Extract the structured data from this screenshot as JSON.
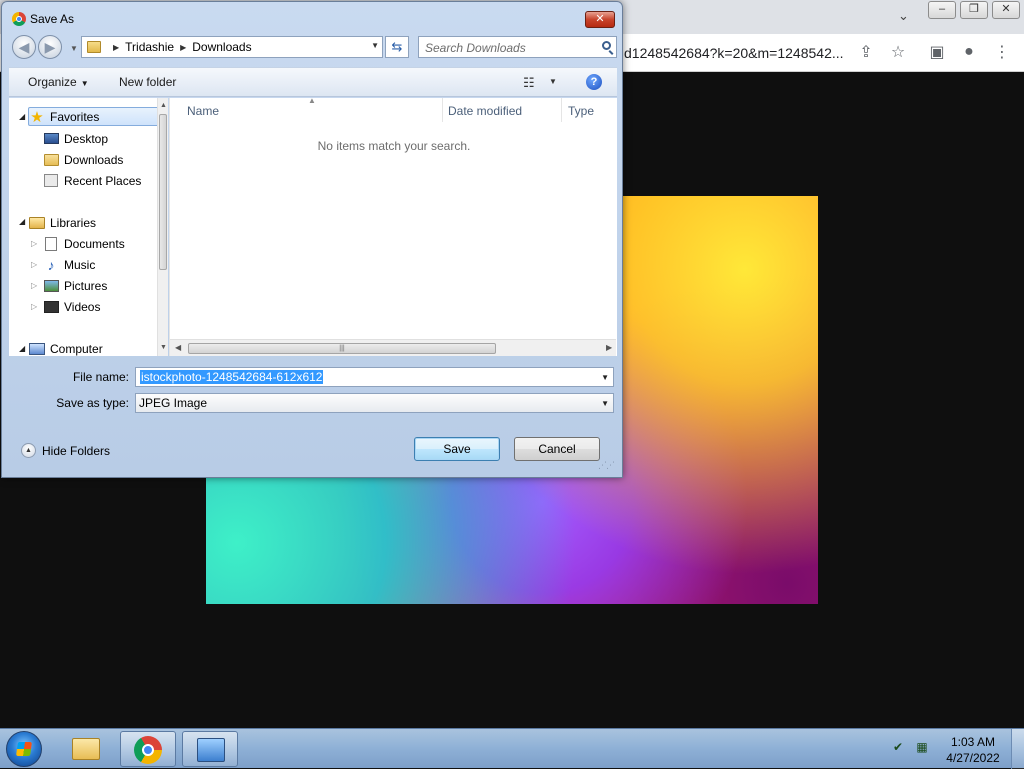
{
  "browser": {
    "url_fragment": "d1248542684?k=20&m=1248542...",
    "window_buttons": [
      "–",
      "❐",
      "✕"
    ]
  },
  "dialog": {
    "title": "Save As",
    "close_glyph": "✕",
    "address": {
      "crumbs": [
        "Tridashie",
        "Downloads"
      ]
    },
    "search_placeholder": "Search Downloads",
    "toolbar": {
      "organize_label": "Organize",
      "new_folder_label": "New folder"
    },
    "nav_tree": {
      "favorites": "Favorites",
      "desktop": "Desktop",
      "downloads": "Downloads",
      "recent_places": "Recent Places",
      "libraries": "Libraries",
      "documents": "Documents",
      "music": "Music",
      "pictures": "Pictures",
      "videos": "Videos",
      "computer": "Computer"
    },
    "columns": {
      "name": "Name",
      "date_modified": "Date modified",
      "type": "Type"
    },
    "empty_message": "No items match your search.",
    "file_name_label": "File name:",
    "file_name_value": "istockphoto-1248542684-612x612",
    "save_type_label": "Save as type:",
    "save_type_value": "JPEG Image",
    "hide_folders_label": "Hide Folders",
    "save_label": "Save",
    "cancel_label": "Cancel"
  },
  "taskbar": {
    "time": "1:03 AM",
    "date": "4/27/2022"
  },
  "icons": {
    "chrome_toolbar": [
      "share-icon",
      "bookmark-star-icon",
      "side-panel-icon",
      "profile-icon",
      "more-menu-icon"
    ],
    "tray": [
      "action-center-icon",
      "network-icon"
    ]
  }
}
